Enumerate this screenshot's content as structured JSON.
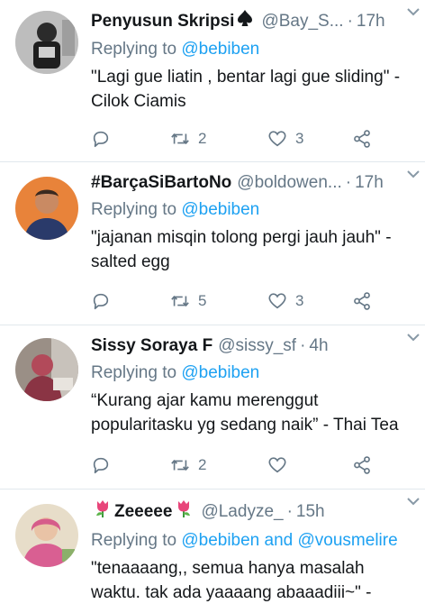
{
  "tweets": [
    {
      "name": "Penyusun Skripsi",
      "name_suffix_icon": "spade-icon",
      "handle": "@Bay_S...",
      "time": "17h",
      "replying_prefix": "Replying to ",
      "replying_to": "@bebiben",
      "text": "\"Lagi gue liatin , bentar lagi gue sliding\" - Cilok Ciamis",
      "retweets": "2",
      "likes": "3"
    },
    {
      "name": "#BarçaSiBartoNo",
      "handle": "@boldowen...",
      "time": "17h",
      "replying_prefix": "Replying to ",
      "replying_to": "@bebiben",
      "text": "\"jajanan misqin tolong pergi jauh jauh\" - salted egg",
      "retweets": "5",
      "likes": "3"
    },
    {
      "name": "Sissy Soraya F",
      "handle": "@sissy_sf",
      "time": "4h",
      "replying_prefix": "Replying to ",
      "replying_to": "@bebiben",
      "text": "“Kurang ajar kamu merenggut popularitasku yg sedang naik” - Thai Tea",
      "retweets": "2",
      "likes": ""
    },
    {
      "name_prefix_icon": "tulip-icon",
      "name": "Zeeeee",
      "name_suffix_icon": "tulip-icon",
      "handle": "@Ladyze_",
      "time": "15h",
      "replying_prefix": "Replying to ",
      "replying_to": "@bebiben and @vousmelire",
      "text": "\"tenaaaang,, semua hanya masalah waktu. tak ada yaaaang abaaadiii~\" -"
    }
  ],
  "separator": "·",
  "colors": {
    "link": "#1da1f2",
    "muted": "#657786",
    "text": "#14171a",
    "divider": "#e1e8ed"
  }
}
